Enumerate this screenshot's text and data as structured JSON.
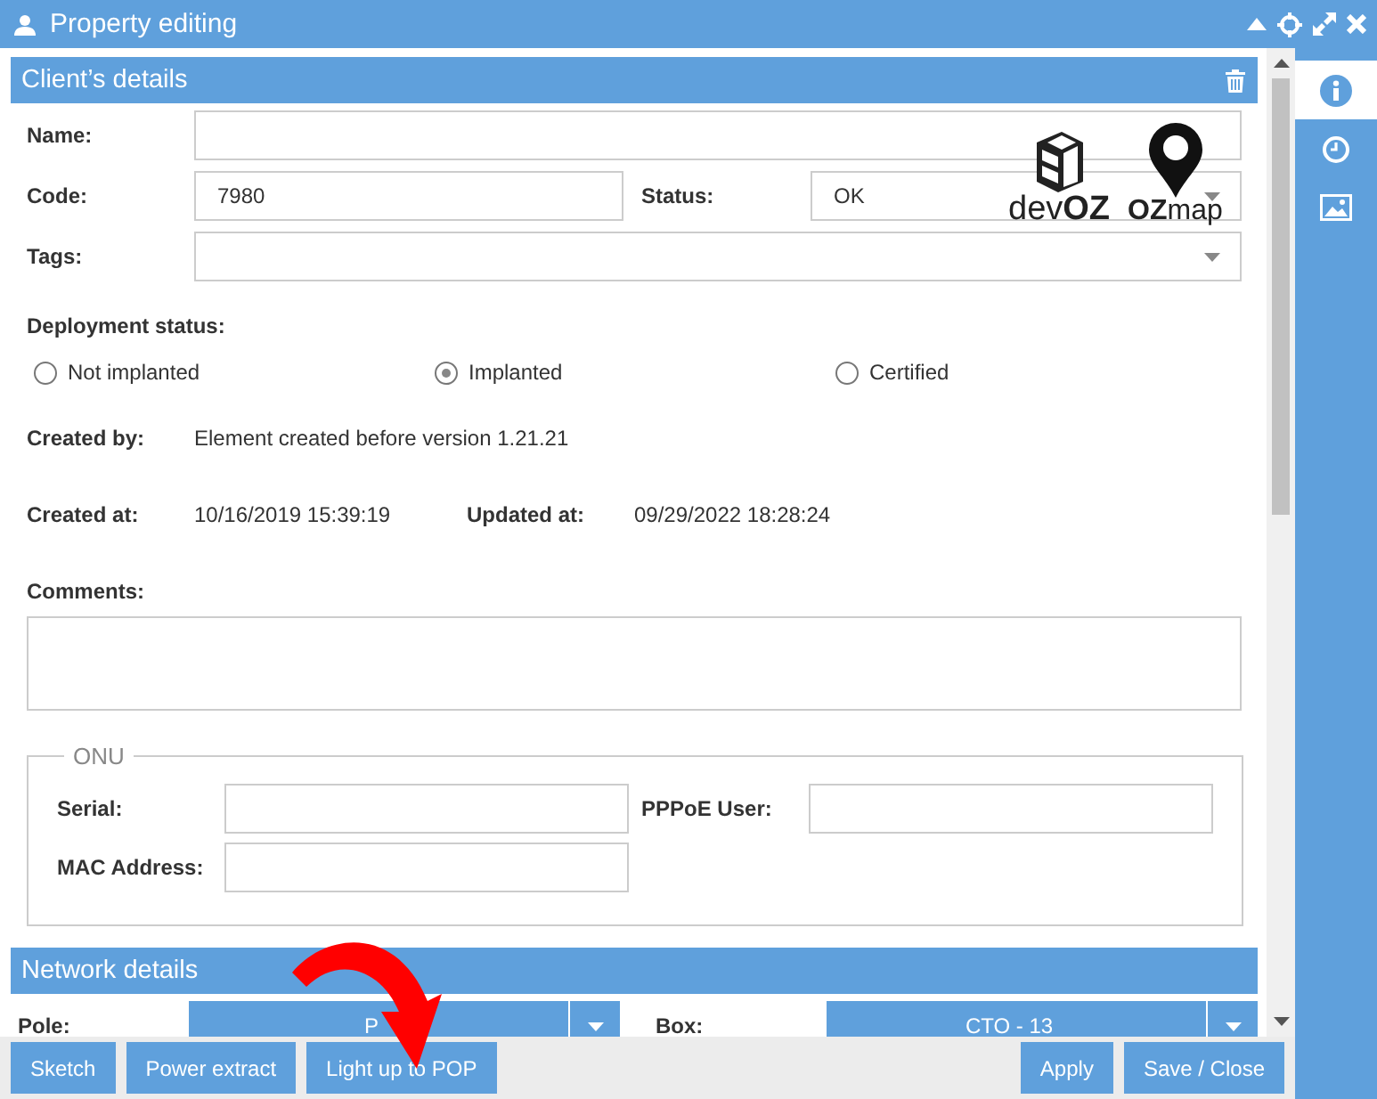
{
  "window": {
    "title": "Property editing"
  },
  "side_tabs": [
    {
      "kind": "info",
      "selected": true
    },
    {
      "kind": "history",
      "selected": false
    },
    {
      "kind": "image",
      "selected": false
    }
  ],
  "client_details": {
    "title": "Client’s details",
    "name": {
      "label": "Name:"
    },
    "code": {
      "label": "Code:",
      "value": "7980"
    },
    "status": {
      "label": "Status:",
      "value": "OK"
    },
    "tags": {
      "label": "Tags:"
    },
    "deployment_status": {
      "label": "Deployment status:",
      "options": [
        {
          "label": "Not implanted",
          "selected": false
        },
        {
          "label": "Implanted",
          "selected": true
        },
        {
          "label": "Certified",
          "selected": false
        }
      ]
    },
    "created_by": {
      "label": "Created by:",
      "value": "Element created before version 1.21.21"
    },
    "created_at": {
      "label": "Created at:",
      "value": "10/16/2019 15:39:19"
    },
    "updated_at": {
      "label": "Updated at:",
      "value": "09/29/2022 18:28:24"
    },
    "comments": {
      "label": "Comments:"
    }
  },
  "onu": {
    "title": "ONU",
    "serial": {
      "label": "Serial:"
    },
    "pppoe_user": {
      "label": "PPPoE User:"
    },
    "mac_address": {
      "label": "MAC Address:"
    }
  },
  "logos": [
    {
      "kind": "devoz",
      "text": "dev**OZ**"
    },
    {
      "kind": "ozmap",
      "text": "**OZ**map"
    }
  ],
  "network_details": {
    "title": "Network details",
    "pole": {
      "label": "Pole:",
      "value": "P"
    },
    "box": {
      "label": "Box:",
      "value": "CTO - 13"
    }
  },
  "footer": {
    "left_buttons": [
      "Sketch",
      "Power extract",
      "Light up to POP"
    ],
    "right_buttons": [
      "Apply",
      "Save / Close"
    ]
  }
}
